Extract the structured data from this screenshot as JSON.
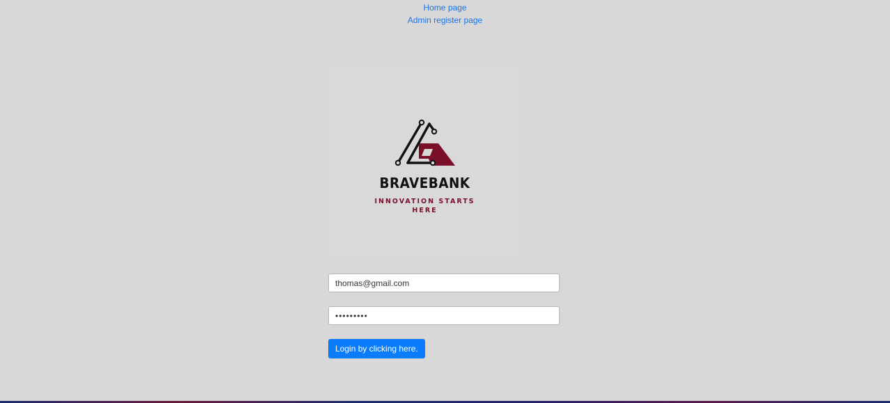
{
  "nav": {
    "home_link": "Home page",
    "admin_register_link": "Admin register page"
  },
  "brand": {
    "name": "BRAVEBANK",
    "tagline": "INNOVATION STARTS HERE",
    "colors": {
      "dark": "#111111",
      "accent": "#7a0f2a"
    }
  },
  "login_form": {
    "email_value": "thomas@gmail.com",
    "password_value": "•••••••••",
    "submit_label": "Login by clicking here."
  },
  "colors": {
    "page_background": "#d8d8d8",
    "link": "#1a73e8",
    "button": "#0b7dfb"
  }
}
